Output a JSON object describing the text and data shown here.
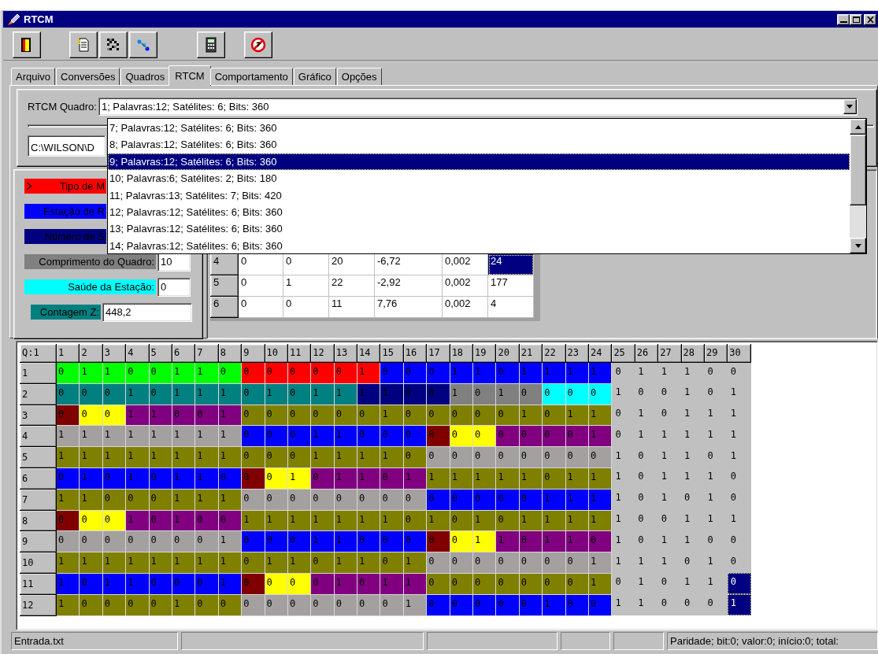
{
  "window": {
    "title": "RTCM"
  },
  "tabs": [
    {
      "label": "Arquivo",
      "selected": false
    },
    {
      "label": "Conversões",
      "selected": false
    },
    {
      "label": "Quadros",
      "selected": false
    },
    {
      "label": "RTCM",
      "selected": true
    },
    {
      "label": "Comportamento",
      "selected": false
    },
    {
      "label": "Gráfico",
      "selected": false
    },
    {
      "label": "Opções",
      "selected": false
    }
  ],
  "frame_selector": {
    "label": "RTCM Quadro:",
    "value": "1; Palavras:12; Satélites: 6; Bits: 360",
    "options": [
      {
        "text": "7; Palavras:12; Satélites: 6; Bits: 360",
        "selected": false
      },
      {
        "text": "8; Palavras:12; Satélites: 6; Bits: 360",
        "selected": false
      },
      {
        "text": "9; Palavras:12; Satélites: 6; Bits: 360",
        "selected": true
      },
      {
        "text": "10; Palavras:6; Satélites: 2; Bits: 180",
        "selected": false
      },
      {
        "text": "11; Palavras:13; Satélites: 7; Bits: 420",
        "selected": false
      },
      {
        "text": "12; Palavras:12; Satélites: 6; Bits: 360",
        "selected": false
      },
      {
        "text": "13; Palavras:12; Satélites: 6; Bits: 360",
        "selected": false
      },
      {
        "text": "14; Palavras:12; Satélites: 6; Bits: 360",
        "selected": false
      }
    ]
  },
  "path_field": {
    "value": "C:\\WILSON\\D"
  },
  "fields": [
    {
      "label": "Tipo de M",
      "color": "#ff0000"
    },
    {
      "label": "Estação de R",
      "color": "#0000ff"
    },
    {
      "label": "Número de S",
      "color": "#000080"
    },
    {
      "label": "Comprimento do Quadro:",
      "color": "#808080",
      "value": "10"
    },
    {
      "label": "Saúde da Estação:",
      "color": "#00ffff",
      "value": "0"
    },
    {
      "label": "Contagem Z:",
      "color": "#008080",
      "value": "448,2"
    }
  ],
  "satellite_table": {
    "rows": [
      {
        "header": "4",
        "cells": [
          {
            "text": "0",
            "selected": false
          },
          {
            "text": "0",
            "selected": false
          },
          {
            "text": "20",
            "selected": false
          },
          {
            "text": "-6,72",
            "selected": false
          },
          {
            "text": "0,002",
            "selected": false
          },
          {
            "text": "24",
            "selected": true
          }
        ]
      },
      {
        "header": "5",
        "cells": [
          {
            "text": "0",
            "selected": false
          },
          {
            "text": "1",
            "selected": false
          },
          {
            "text": "22",
            "selected": false
          },
          {
            "text": "-2,92",
            "selected": false
          },
          {
            "text": "0,002",
            "selected": false
          },
          {
            "text": "177",
            "selected": false
          }
        ]
      },
      {
        "header": "6",
        "cells": [
          {
            "text": "0",
            "selected": false
          },
          {
            "text": "0",
            "selected": false
          },
          {
            "text": "11",
            "selected": false
          },
          {
            "text": "7,76",
            "selected": false
          },
          {
            "text": "0,002",
            "selected": false
          },
          {
            "text": "4",
            "selected": false
          }
        ]
      }
    ]
  },
  "bit_grid": {
    "corner": "Q:1",
    "columns": [
      "1",
      "2",
      "3",
      "4",
      "5",
      "6",
      "7",
      "8",
      "9",
      "10",
      "11",
      "12",
      "13",
      "14",
      "15",
      "16",
      "17",
      "18",
      "19",
      "20",
      "21",
      "22",
      "23",
      "24",
      "25",
      "26",
      "27",
      "28",
      "29",
      "30"
    ],
    "rows": [
      {
        "header": "1",
        "cells": [
          {
            "text": "0",
            "color": "#00ff00"
          },
          {
            "text": "1",
            "color": "#00ff00"
          },
          {
            "text": "1",
            "color": "#00ff00"
          },
          {
            "text": "0",
            "color": "#00ff00"
          },
          {
            "text": "0",
            "color": "#00ff00"
          },
          {
            "text": "1",
            "color": "#00ff00"
          },
          {
            "text": "1",
            "color": "#00ff00"
          },
          {
            "text": "0",
            "color": "#00ff00"
          },
          {
            "text": "0",
            "color": "#ff0000"
          },
          {
            "text": "0",
            "color": "#ff0000"
          },
          {
            "text": "0",
            "color": "#ff0000"
          },
          {
            "text": "0",
            "color": "#ff0000"
          },
          {
            "text": "0",
            "color": "#ff0000"
          },
          {
            "text": "1",
            "color": "#ff0000"
          },
          {
            "text": "0",
            "color": "#0000ff"
          },
          {
            "text": "0",
            "color": "#0000ff"
          },
          {
            "text": "0",
            "color": "#0000ff"
          },
          {
            "text": "1",
            "color": "#0000ff"
          },
          {
            "text": "1",
            "color": "#0000ff"
          },
          {
            "text": "0",
            "color": "#0000ff"
          },
          {
            "text": "1",
            "color": "#0000ff"
          },
          {
            "text": "1",
            "color": "#0000ff"
          },
          {
            "text": "1",
            "color": "#0000ff"
          },
          {
            "text": "1",
            "color": "#0000ff"
          }
        ],
        "tail": [
          {
            "text": "0",
            "selected": false
          },
          {
            "text": "1",
            "selected": false
          },
          {
            "text": "1",
            "selected": false
          },
          {
            "text": "1",
            "selected": false
          },
          {
            "text": "0",
            "selected": false
          },
          {
            "text": "0",
            "selected": false
          }
        ]
      },
      {
        "header": "2",
        "cells": [
          {
            "text": "0",
            "color": "#008080"
          },
          {
            "text": "0",
            "color": "#008080"
          },
          {
            "text": "0",
            "color": "#008080"
          },
          {
            "text": "1",
            "color": "#008080"
          },
          {
            "text": "0",
            "color": "#008080"
          },
          {
            "text": "1",
            "color": "#008080"
          },
          {
            "text": "1",
            "color": "#008080"
          },
          {
            "text": "1",
            "color": "#008080"
          },
          {
            "text": "0",
            "color": "#008080"
          },
          {
            "text": "1",
            "color": "#008080"
          },
          {
            "text": "0",
            "color": "#008080"
          },
          {
            "text": "1",
            "color": "#008080"
          },
          {
            "text": "1",
            "color": "#008080"
          },
          {
            "text": "1",
            "color": "#000080"
          },
          {
            "text": "1",
            "color": "#000080"
          },
          {
            "text": "0",
            "color": "#000080"
          },
          {
            "text": "0",
            "color": "#000080"
          },
          {
            "text": "1",
            "color": "#808080"
          },
          {
            "text": "0",
            "color": "#808080"
          },
          {
            "text": "1",
            "color": "#808080"
          },
          {
            "text": "0",
            "color": "#808080"
          },
          {
            "text": "0",
            "color": "#00ffff"
          },
          {
            "text": "0",
            "color": "#00ffff"
          },
          {
            "text": "0",
            "color": "#00ffff"
          }
        ],
        "tail": [
          {
            "text": "1",
            "selected": false
          },
          {
            "text": "0",
            "selected": false
          },
          {
            "text": "0",
            "selected": false
          },
          {
            "text": "1",
            "selected": false
          },
          {
            "text": "0",
            "selected": false
          },
          {
            "text": "1",
            "selected": false
          }
        ]
      },
      {
        "header": "3",
        "cells": [
          {
            "text": "0",
            "color": "#800000"
          },
          {
            "text": "0",
            "color": "#ffff00"
          },
          {
            "text": "0",
            "color": "#ffff00"
          },
          {
            "text": "1",
            "color": "#800080"
          },
          {
            "text": "1",
            "color": "#800080"
          },
          {
            "text": "0",
            "color": "#800080"
          },
          {
            "text": "0",
            "color": "#800080"
          },
          {
            "text": "1",
            "color": "#800080"
          },
          {
            "text": "0",
            "color": "#808000"
          },
          {
            "text": "0",
            "color": "#808000"
          },
          {
            "text": "0",
            "color": "#808000"
          },
          {
            "text": "0",
            "color": "#808000"
          },
          {
            "text": "0",
            "color": "#808000"
          },
          {
            "text": "0",
            "color": "#808000"
          },
          {
            "text": "1",
            "color": "#808000"
          },
          {
            "text": "0",
            "color": "#808000"
          },
          {
            "text": "0",
            "color": "#808000"
          },
          {
            "text": "0",
            "color": "#808000"
          },
          {
            "text": "0",
            "color": "#808000"
          },
          {
            "text": "0",
            "color": "#808000"
          },
          {
            "text": "1",
            "color": "#808000"
          },
          {
            "text": "0",
            "color": "#808000"
          },
          {
            "text": "1",
            "color": "#808000"
          },
          {
            "text": "1",
            "color": "#808000"
          }
        ],
        "tail": [
          {
            "text": "0",
            "selected": false
          },
          {
            "text": "1",
            "selected": false
          },
          {
            "text": "0",
            "selected": false
          },
          {
            "text": "1",
            "selected": false
          },
          {
            "text": "1",
            "selected": false
          },
          {
            "text": "1",
            "selected": false
          }
        ]
      },
      {
        "header": "4",
        "cells": [
          {
            "text": "1",
            "color": "#a4a0a0"
          },
          {
            "text": "1",
            "color": "#a4a0a0"
          },
          {
            "text": "1",
            "color": "#a4a0a0"
          },
          {
            "text": "1",
            "color": "#a4a0a0"
          },
          {
            "text": "1",
            "color": "#a4a0a0"
          },
          {
            "text": "1",
            "color": "#a4a0a0"
          },
          {
            "text": "1",
            "color": "#a4a0a0"
          },
          {
            "text": "1",
            "color": "#a4a0a0"
          },
          {
            "text": "0",
            "color": "#0000ff"
          },
          {
            "text": "0",
            "color": "#0000ff"
          },
          {
            "text": "0",
            "color": "#0000ff"
          },
          {
            "text": "1",
            "color": "#0000ff"
          },
          {
            "text": "1",
            "color": "#0000ff"
          },
          {
            "text": "0",
            "color": "#0000ff"
          },
          {
            "text": "0",
            "color": "#0000ff"
          },
          {
            "text": "0",
            "color": "#0000ff"
          },
          {
            "text": "0",
            "color": "#800000"
          },
          {
            "text": "0",
            "color": "#ffff00"
          },
          {
            "text": "0",
            "color": "#ffff00"
          },
          {
            "text": "0",
            "color": "#800080"
          },
          {
            "text": "0",
            "color": "#800080"
          },
          {
            "text": "0",
            "color": "#800080"
          },
          {
            "text": "0",
            "color": "#800080"
          },
          {
            "text": "1",
            "color": "#800080"
          }
        ],
        "tail": [
          {
            "text": "0",
            "selected": false
          },
          {
            "text": "1",
            "selected": false
          },
          {
            "text": "1",
            "selected": false
          },
          {
            "text": "1",
            "selected": false
          },
          {
            "text": "1",
            "selected": false
          },
          {
            "text": "1",
            "selected": false
          }
        ]
      },
      {
        "header": "5",
        "cells": [
          {
            "text": "1",
            "color": "#808000"
          },
          {
            "text": "1",
            "color": "#808000"
          },
          {
            "text": "1",
            "color": "#808000"
          },
          {
            "text": "1",
            "color": "#808000"
          },
          {
            "text": "1",
            "color": "#808000"
          },
          {
            "text": "1",
            "color": "#808000"
          },
          {
            "text": "1",
            "color": "#808000"
          },
          {
            "text": "1",
            "color": "#808000"
          },
          {
            "text": "0",
            "color": "#808000"
          },
          {
            "text": "0",
            "color": "#808000"
          },
          {
            "text": "0",
            "color": "#808000"
          },
          {
            "text": "1",
            "color": "#808000"
          },
          {
            "text": "1",
            "color": "#808000"
          },
          {
            "text": "1",
            "color": "#808000"
          },
          {
            "text": "1",
            "color": "#808000"
          },
          {
            "text": "0",
            "color": "#808000"
          },
          {
            "text": "0",
            "color": "#a4a0a0"
          },
          {
            "text": "0",
            "color": "#a4a0a0"
          },
          {
            "text": "0",
            "color": "#a4a0a0"
          },
          {
            "text": "0",
            "color": "#a4a0a0"
          },
          {
            "text": "0",
            "color": "#a4a0a0"
          },
          {
            "text": "0",
            "color": "#a4a0a0"
          },
          {
            "text": "0",
            "color": "#a4a0a0"
          },
          {
            "text": "0",
            "color": "#a4a0a0"
          }
        ],
        "tail": [
          {
            "text": "1",
            "selected": false
          },
          {
            "text": "0",
            "selected": false
          },
          {
            "text": "1",
            "selected": false
          },
          {
            "text": "1",
            "selected": false
          },
          {
            "text": "0",
            "selected": false
          },
          {
            "text": "1",
            "selected": false
          }
        ]
      },
      {
        "header": "6",
        "cells": [
          {
            "text": "0",
            "color": "#0000ff"
          },
          {
            "text": "1",
            "color": "#0000ff"
          },
          {
            "text": "0",
            "color": "#0000ff"
          },
          {
            "text": "1",
            "color": "#0000ff"
          },
          {
            "text": "0",
            "color": "#0000ff"
          },
          {
            "text": "1",
            "color": "#0000ff"
          },
          {
            "text": "1",
            "color": "#0000ff"
          },
          {
            "text": "0",
            "color": "#0000ff"
          },
          {
            "text": "0",
            "color": "#800000"
          },
          {
            "text": "0",
            "color": "#ffff00"
          },
          {
            "text": "1",
            "color": "#ffff00"
          },
          {
            "text": "0",
            "color": "#800080"
          },
          {
            "text": "1",
            "color": "#800080"
          },
          {
            "text": "1",
            "color": "#800080"
          },
          {
            "text": "0",
            "color": "#800080"
          },
          {
            "text": "1",
            "color": "#800080"
          },
          {
            "text": "1",
            "color": "#808000"
          },
          {
            "text": "1",
            "color": "#808000"
          },
          {
            "text": "1",
            "color": "#808000"
          },
          {
            "text": "1",
            "color": "#808000"
          },
          {
            "text": "1",
            "color": "#808000"
          },
          {
            "text": "0",
            "color": "#808000"
          },
          {
            "text": "1",
            "color": "#808000"
          },
          {
            "text": "1",
            "color": "#808000"
          }
        ],
        "tail": [
          {
            "text": "1",
            "selected": false
          },
          {
            "text": "0",
            "selected": false
          },
          {
            "text": "1",
            "selected": false
          },
          {
            "text": "1",
            "selected": false
          },
          {
            "text": "1",
            "selected": false
          },
          {
            "text": "0",
            "selected": false
          }
        ]
      },
      {
        "header": "7",
        "cells": [
          {
            "text": "1",
            "color": "#808000"
          },
          {
            "text": "1",
            "color": "#808000"
          },
          {
            "text": "0",
            "color": "#808000"
          },
          {
            "text": "0",
            "color": "#808000"
          },
          {
            "text": "0",
            "color": "#808000"
          },
          {
            "text": "1",
            "color": "#808000"
          },
          {
            "text": "1",
            "color": "#808000"
          },
          {
            "text": "1",
            "color": "#808000"
          },
          {
            "text": "0",
            "color": "#a4a0a0"
          },
          {
            "text": "0",
            "color": "#a4a0a0"
          },
          {
            "text": "0",
            "color": "#a4a0a0"
          },
          {
            "text": "0",
            "color": "#a4a0a0"
          },
          {
            "text": "0",
            "color": "#a4a0a0"
          },
          {
            "text": "0",
            "color": "#a4a0a0"
          },
          {
            "text": "0",
            "color": "#a4a0a0"
          },
          {
            "text": "0",
            "color": "#a4a0a0"
          },
          {
            "text": "0",
            "color": "#0000ff"
          },
          {
            "text": "0",
            "color": "#0000ff"
          },
          {
            "text": "0",
            "color": "#0000ff"
          },
          {
            "text": "0",
            "color": "#0000ff"
          },
          {
            "text": "0",
            "color": "#0000ff"
          },
          {
            "text": "1",
            "color": "#0000ff"
          },
          {
            "text": "1",
            "color": "#0000ff"
          },
          {
            "text": "1",
            "color": "#0000ff"
          }
        ],
        "tail": [
          {
            "text": "1",
            "selected": false
          },
          {
            "text": "0",
            "selected": false
          },
          {
            "text": "1",
            "selected": false
          },
          {
            "text": "0",
            "selected": false
          },
          {
            "text": "1",
            "selected": false
          },
          {
            "text": "0",
            "selected": false
          }
        ]
      },
      {
        "header": "8",
        "cells": [
          {
            "text": "0",
            "color": "#800000"
          },
          {
            "text": "0",
            "color": "#ffff00"
          },
          {
            "text": "0",
            "color": "#ffff00"
          },
          {
            "text": "1",
            "color": "#800080"
          },
          {
            "text": "0",
            "color": "#800080"
          },
          {
            "text": "1",
            "color": "#800080"
          },
          {
            "text": "0",
            "color": "#800080"
          },
          {
            "text": "0",
            "color": "#800080"
          },
          {
            "text": "1",
            "color": "#808000"
          },
          {
            "text": "1",
            "color": "#808000"
          },
          {
            "text": "1",
            "color": "#808000"
          },
          {
            "text": "1",
            "color": "#808000"
          },
          {
            "text": "1",
            "color": "#808000"
          },
          {
            "text": "1",
            "color": "#808000"
          },
          {
            "text": "1",
            "color": "#808000"
          },
          {
            "text": "0",
            "color": "#808000"
          },
          {
            "text": "1",
            "color": "#808000"
          },
          {
            "text": "0",
            "color": "#808000"
          },
          {
            "text": "1",
            "color": "#808000"
          },
          {
            "text": "0",
            "color": "#808000"
          },
          {
            "text": "1",
            "color": "#808000"
          },
          {
            "text": "1",
            "color": "#808000"
          },
          {
            "text": "1",
            "color": "#808000"
          },
          {
            "text": "1",
            "color": "#808000"
          }
        ],
        "tail": [
          {
            "text": "1",
            "selected": false
          },
          {
            "text": "0",
            "selected": false
          },
          {
            "text": "0",
            "selected": false
          },
          {
            "text": "1",
            "selected": false
          },
          {
            "text": "1",
            "selected": false
          },
          {
            "text": "1",
            "selected": false
          }
        ]
      },
      {
        "header": "9",
        "cells": [
          {
            "text": "0",
            "color": "#a4a0a0"
          },
          {
            "text": "0",
            "color": "#a4a0a0"
          },
          {
            "text": "0",
            "color": "#a4a0a0"
          },
          {
            "text": "0",
            "color": "#a4a0a0"
          },
          {
            "text": "0",
            "color": "#a4a0a0"
          },
          {
            "text": "0",
            "color": "#a4a0a0"
          },
          {
            "text": "0",
            "color": "#a4a0a0"
          },
          {
            "text": "1",
            "color": "#a4a0a0"
          },
          {
            "text": "0",
            "color": "#0000ff"
          },
          {
            "text": "0",
            "color": "#0000ff"
          },
          {
            "text": "0",
            "color": "#0000ff"
          },
          {
            "text": "1",
            "color": "#0000ff"
          },
          {
            "text": "1",
            "color": "#0000ff"
          },
          {
            "text": "0",
            "color": "#0000ff"
          },
          {
            "text": "0",
            "color": "#0000ff"
          },
          {
            "text": "0",
            "color": "#0000ff"
          },
          {
            "text": "0",
            "color": "#800000"
          },
          {
            "text": "0",
            "color": "#ffff00"
          },
          {
            "text": "1",
            "color": "#ffff00"
          },
          {
            "text": "1",
            "color": "#800080"
          },
          {
            "text": "0",
            "color": "#800080"
          },
          {
            "text": "1",
            "color": "#800080"
          },
          {
            "text": "1",
            "color": "#800080"
          },
          {
            "text": "0",
            "color": "#800080"
          }
        ],
        "tail": [
          {
            "text": "1",
            "selected": false
          },
          {
            "text": "0",
            "selected": false
          },
          {
            "text": "1",
            "selected": false
          },
          {
            "text": "1",
            "selected": false
          },
          {
            "text": "0",
            "selected": false
          },
          {
            "text": "0",
            "selected": false
          }
        ]
      },
      {
        "header": "10",
        "cells": [
          {
            "text": "1",
            "color": "#808000"
          },
          {
            "text": "1",
            "color": "#808000"
          },
          {
            "text": "1",
            "color": "#808000"
          },
          {
            "text": "1",
            "color": "#808000"
          },
          {
            "text": "1",
            "color": "#808000"
          },
          {
            "text": "1",
            "color": "#808000"
          },
          {
            "text": "1",
            "color": "#808000"
          },
          {
            "text": "1",
            "color": "#808000"
          },
          {
            "text": "0",
            "color": "#808000"
          },
          {
            "text": "1",
            "color": "#808000"
          },
          {
            "text": "1",
            "color": "#808000"
          },
          {
            "text": "0",
            "color": "#808000"
          },
          {
            "text": "1",
            "color": "#808000"
          },
          {
            "text": "1",
            "color": "#808000"
          },
          {
            "text": "0",
            "color": "#808000"
          },
          {
            "text": "1",
            "color": "#808000"
          },
          {
            "text": "0",
            "color": "#a4a0a0"
          },
          {
            "text": "0",
            "color": "#a4a0a0"
          },
          {
            "text": "0",
            "color": "#a4a0a0"
          },
          {
            "text": "0",
            "color": "#a4a0a0"
          },
          {
            "text": "0",
            "color": "#a4a0a0"
          },
          {
            "text": "0",
            "color": "#a4a0a0"
          },
          {
            "text": "0",
            "color": "#a4a0a0"
          },
          {
            "text": "1",
            "color": "#a4a0a0"
          }
        ],
        "tail": [
          {
            "text": "1",
            "selected": false
          },
          {
            "text": "1",
            "selected": false
          },
          {
            "text": "1",
            "selected": false
          },
          {
            "text": "0",
            "selected": false
          },
          {
            "text": "1",
            "selected": false
          },
          {
            "text": "0",
            "selected": false
          }
        ]
      },
      {
        "header": "11",
        "cells": [
          {
            "text": "1",
            "color": "#0000ff"
          },
          {
            "text": "0",
            "color": "#0000ff"
          },
          {
            "text": "1",
            "color": "#0000ff"
          },
          {
            "text": "1",
            "color": "#0000ff"
          },
          {
            "text": "0",
            "color": "#0000ff"
          },
          {
            "text": "0",
            "color": "#0000ff"
          },
          {
            "text": "0",
            "color": "#0000ff"
          },
          {
            "text": "1",
            "color": "#0000ff"
          },
          {
            "text": "0",
            "color": "#800000"
          },
          {
            "text": "0",
            "color": "#ffff00"
          },
          {
            "text": "0",
            "color": "#ffff00"
          },
          {
            "text": "0",
            "color": "#800080"
          },
          {
            "text": "1",
            "color": "#800080"
          },
          {
            "text": "0",
            "color": "#800080"
          },
          {
            "text": "1",
            "color": "#800080"
          },
          {
            "text": "1",
            "color": "#800080"
          },
          {
            "text": "0",
            "color": "#808000"
          },
          {
            "text": "0",
            "color": "#808000"
          },
          {
            "text": "0",
            "color": "#808000"
          },
          {
            "text": "0",
            "color": "#808000"
          },
          {
            "text": "0",
            "color": "#808000"
          },
          {
            "text": "0",
            "color": "#808000"
          },
          {
            "text": "0",
            "color": "#808000"
          },
          {
            "text": "1",
            "color": "#808000"
          }
        ],
        "tail": [
          {
            "text": "0",
            "selected": false
          },
          {
            "text": "1",
            "selected": false
          },
          {
            "text": "0",
            "selected": false
          },
          {
            "text": "1",
            "selected": false
          },
          {
            "text": "1",
            "selected": false
          },
          {
            "text": "0",
            "selected": true
          }
        ]
      },
      {
        "header": "12",
        "cells": [
          {
            "text": "1",
            "color": "#808000"
          },
          {
            "text": "0",
            "color": "#808000"
          },
          {
            "text": "0",
            "color": "#808000"
          },
          {
            "text": "0",
            "color": "#808000"
          },
          {
            "text": "0",
            "color": "#808000"
          },
          {
            "text": "1",
            "color": "#808000"
          },
          {
            "text": "0",
            "color": "#808000"
          },
          {
            "text": "0",
            "color": "#808000"
          },
          {
            "text": "0",
            "color": "#a4a0a0"
          },
          {
            "text": "0",
            "color": "#a4a0a0"
          },
          {
            "text": "0",
            "color": "#a4a0a0"
          },
          {
            "text": "0",
            "color": "#a4a0a0"
          },
          {
            "text": "0",
            "color": "#a4a0a0"
          },
          {
            "text": "0",
            "color": "#a4a0a0"
          },
          {
            "text": "0",
            "color": "#a4a0a0"
          },
          {
            "text": "1",
            "color": "#a4a0a0"
          },
          {
            "text": "0",
            "color": "#0000ff"
          },
          {
            "text": "0",
            "color": "#0000ff"
          },
          {
            "text": "0",
            "color": "#0000ff"
          },
          {
            "text": "0",
            "color": "#0000ff"
          },
          {
            "text": "0",
            "color": "#0000ff"
          },
          {
            "text": "1",
            "color": "#0000ff"
          },
          {
            "text": "0",
            "color": "#0000ff"
          },
          {
            "text": "0",
            "color": "#0000ff"
          }
        ],
        "tail": [
          {
            "text": "1",
            "selected": false
          },
          {
            "text": "1",
            "selected": false
          },
          {
            "text": "0",
            "selected": false
          },
          {
            "text": "0",
            "selected": false
          },
          {
            "text": "0",
            "selected": false
          },
          {
            "text": "1",
            "selected": true
          }
        ]
      }
    ]
  },
  "status_bar": {
    "file": "Entrada.txt",
    "parity": "Paridade; bit:0; valor:0; início:0; total:"
  }
}
